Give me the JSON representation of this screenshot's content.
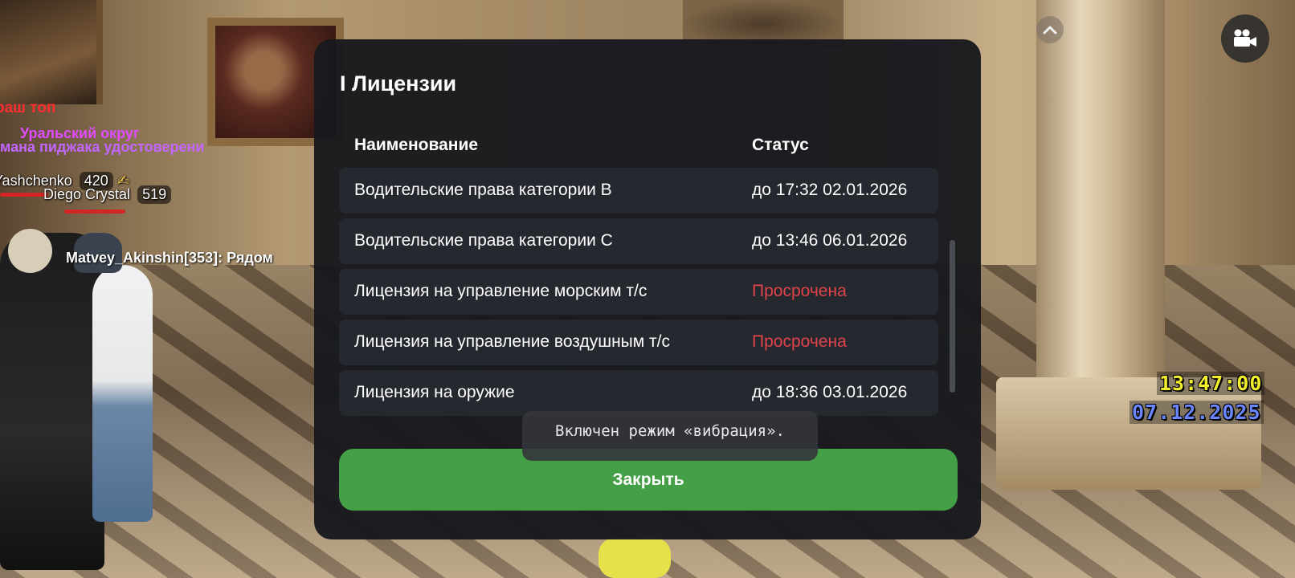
{
  "hud": {
    "nameplates": {
      "line_red": "раш топ",
      "line_purple1": "Уральский округ",
      "line_purple2": "мана пиджака удостоверени",
      "player1_name": "Yashchenko",
      "player1_level": "420",
      "player1_emoji": "✍",
      "player2_name": "Diego Crystal",
      "player2_level": "519",
      "chat_line": "Matvey_Akinshin[353]: Рядом"
    },
    "clock": {
      "time": "13:47:00",
      "date": "07.12.2025",
      "time_color": "#f4ef2e",
      "date_color": "#6a86ff"
    },
    "icons": {
      "collapse": "chevron-up-icon",
      "camera": "video-camera-icon"
    }
  },
  "dialog": {
    "title": "I Лицензии",
    "columns": {
      "name": "Наименование",
      "status": "Статус"
    },
    "rows": [
      {
        "name": "Водительские права категории B",
        "status": "до 17:32 02.01.2026",
        "expired": false
      },
      {
        "name": "Водительские права категории C",
        "status": "до 13:46 06.01.2026",
        "expired": false
      },
      {
        "name": "Лицензия на управление морским т/с",
        "status": "Просрочена",
        "expired": true
      },
      {
        "name": "Лицензия на управление воздушным т/с",
        "status": "Просрочена",
        "expired": true
      },
      {
        "name": "Лицензия на оружие",
        "status": "до 18:36 03.01.2026",
        "expired": false
      }
    ],
    "close_label": "Закрыть",
    "colors": {
      "background": "#18191e",
      "row": "#262830",
      "expired": "#e0434a",
      "close_button": "#43a047"
    }
  },
  "toast": {
    "message": "Включен режим «вибрация»."
  }
}
